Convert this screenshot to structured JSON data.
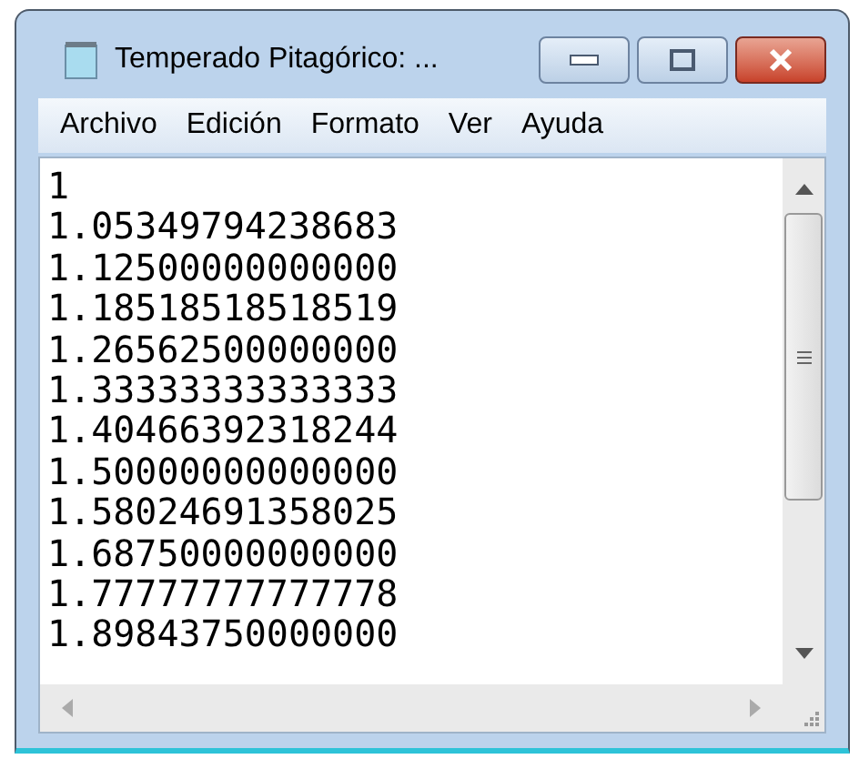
{
  "window": {
    "title": "Temperado Pitagórico: ..."
  },
  "menu": [
    "Archivo",
    "Edición",
    "Formato",
    "Ver",
    "Ayuda"
  ],
  "lines": [
    "1",
    "1.05349794238683",
    "1.12500000000000",
    "1.18518518518519",
    "1.26562500000000",
    "1.33333333333333",
    "1.40466392318244",
    "1.50000000000000",
    "1.58024691358025",
    "1.68750000000000",
    "1.77777777777778",
    "1.89843750000000"
  ]
}
